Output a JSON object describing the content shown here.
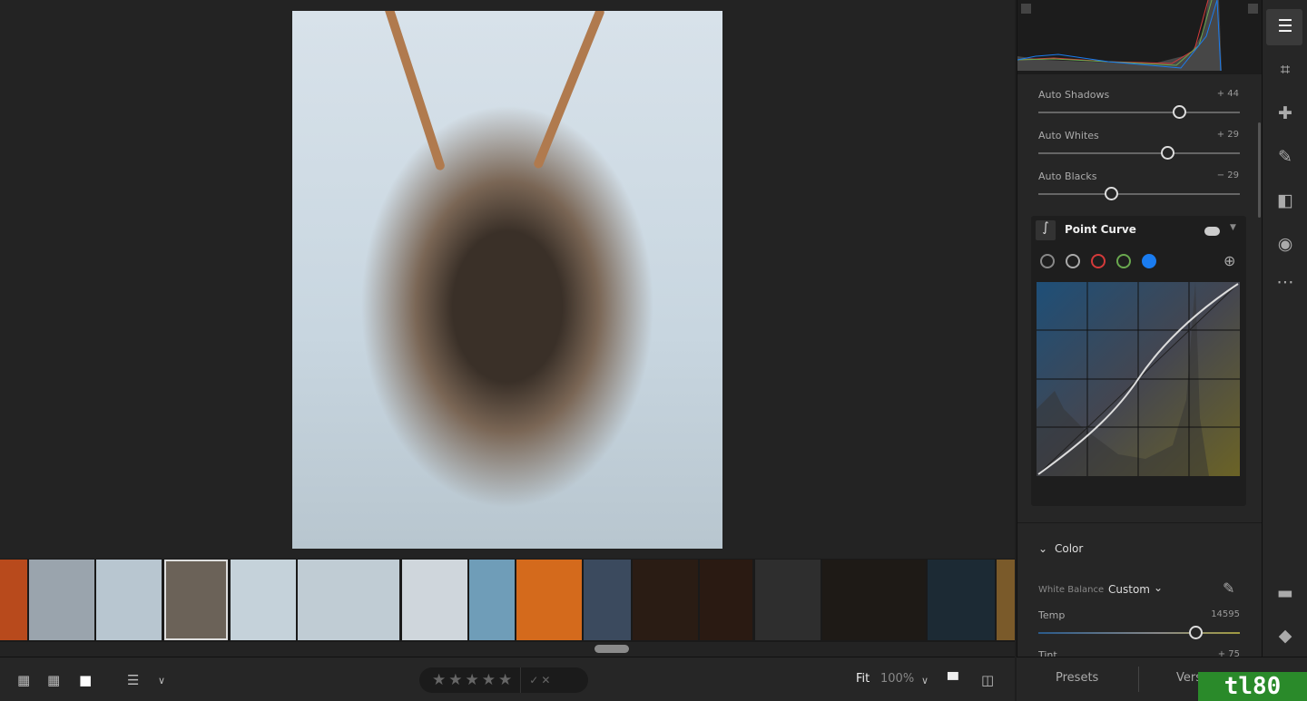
{
  "toolbar": {
    "view_icons": [
      "grid-large-icon",
      "grid-small-icon",
      "single-view-icon"
    ],
    "sort_icon": "sort-icon",
    "stars": [
      "★",
      "★",
      "★",
      "★",
      "★"
    ],
    "flags": [
      "✓",
      "✕"
    ],
    "fit_label": "Fit",
    "zoom_value": "100%",
    "filmstrip_icon": "filmstrip-icon",
    "compare_icon": "compare-icon"
  },
  "filmstrip": {
    "selected_index": 3,
    "thumbs": [
      "#b84a1c",
      "#9aa4ad",
      "#b8c6d0",
      "#6b6258",
      "#c5d2da",
      "#c0ccd4",
      "#cfd6dc",
      "#6f9db8",
      "#d46a1c",
      "#3b4a5e",
      "#2a1c14",
      "#2a1a12",
      "#2e2e2e",
      "#1e1a16",
      "#1c2a34",
      "#7a5a2a"
    ]
  },
  "panel": {
    "sliders": [
      {
        "label": "Auto Shadows",
        "value": "+ 44",
        "position": 0.7
      },
      {
        "label": "Auto Whites",
        "value": "+ 29",
        "position": 0.64
      },
      {
        "label": "Auto Blacks",
        "value": "− 29",
        "position": 0.36
      }
    ],
    "point_curve": {
      "title": "Point Curve",
      "enabled": true,
      "channels": [
        {
          "name": "parametric",
          "color": "#888"
        },
        {
          "name": "rgb",
          "color": "#aaa"
        },
        {
          "name": "red",
          "color": "#d43a3a"
        },
        {
          "name": "green",
          "color": "#6aa84f"
        },
        {
          "name": "blue",
          "color": "#1a7cf0"
        }
      ],
      "selected_channel": "blue"
    },
    "color": {
      "title": "Color",
      "white_balance_label": "White Balance",
      "white_balance_value": "Custom",
      "temp_label": "Temp",
      "temp_value": "14595",
      "temp_position": 0.78,
      "tint_label": "Tint",
      "tint_value": "+ 75"
    }
  },
  "bottom_tabs": {
    "presets": "Presets",
    "versions": "Vers"
  },
  "rail": [
    "edit-sliders-icon",
    "crop-icon",
    "healing-icon",
    "brush-icon",
    "linear-gradient-icon",
    "radial-gradient-icon",
    "more-icon"
  ],
  "rail_bottom": [
    "comment-icon",
    "tag-icon"
  ],
  "watermark": "tl80"
}
